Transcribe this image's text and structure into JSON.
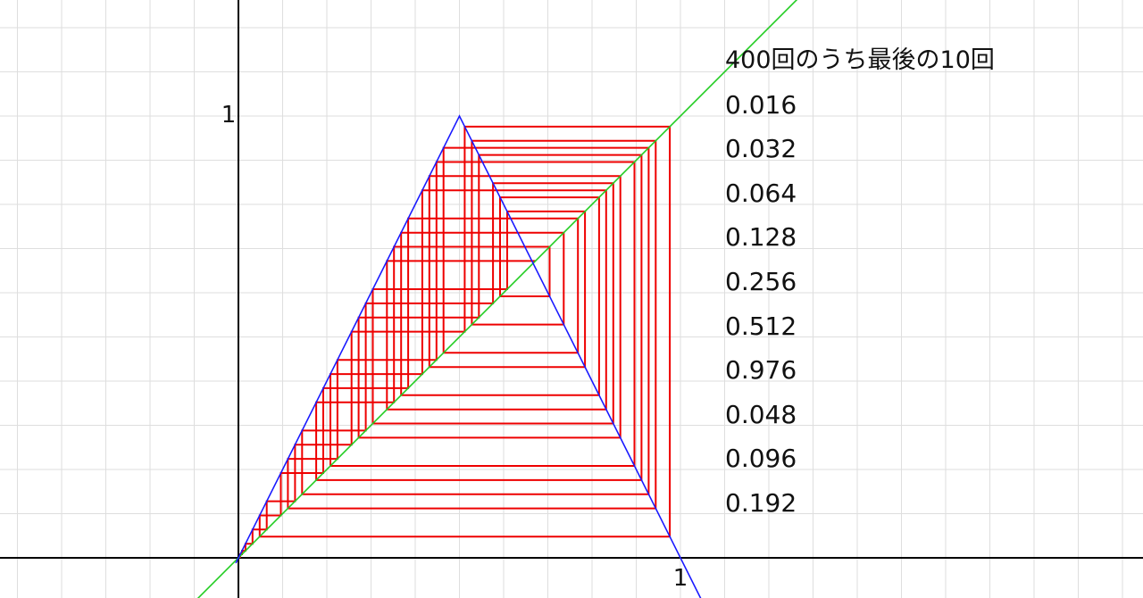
{
  "chart_data": {
    "type": "line",
    "title": "",
    "xlabel": "",
    "ylabel": "",
    "axis_ticks": {
      "x": "1",
      "y": "1"
    },
    "xlim": [
      -0.54,
      2.05
    ],
    "ylim": [
      -0.1,
      1.25
    ],
    "grid": true,
    "functions": [
      {
        "kind": "tent map f(x) = 2x (x < 0.5), 2 - 2x (x ≥ 0.5)",
        "color": "#1a1aff"
      },
      {
        "kind": "diagonal y = x",
        "color": "#22cc22"
      }
    ],
    "cobweb": {
      "color": "#ee0000",
      "x0": 0.004,
      "iterations_drawn": 45
    },
    "annotation_title": "400回のうち最後の10回",
    "last_values": [
      "0.016",
      "0.032",
      "0.064",
      "0.128",
      "0.256",
      "0.512",
      "0.976",
      "0.048",
      "0.096",
      "0.192"
    ]
  }
}
